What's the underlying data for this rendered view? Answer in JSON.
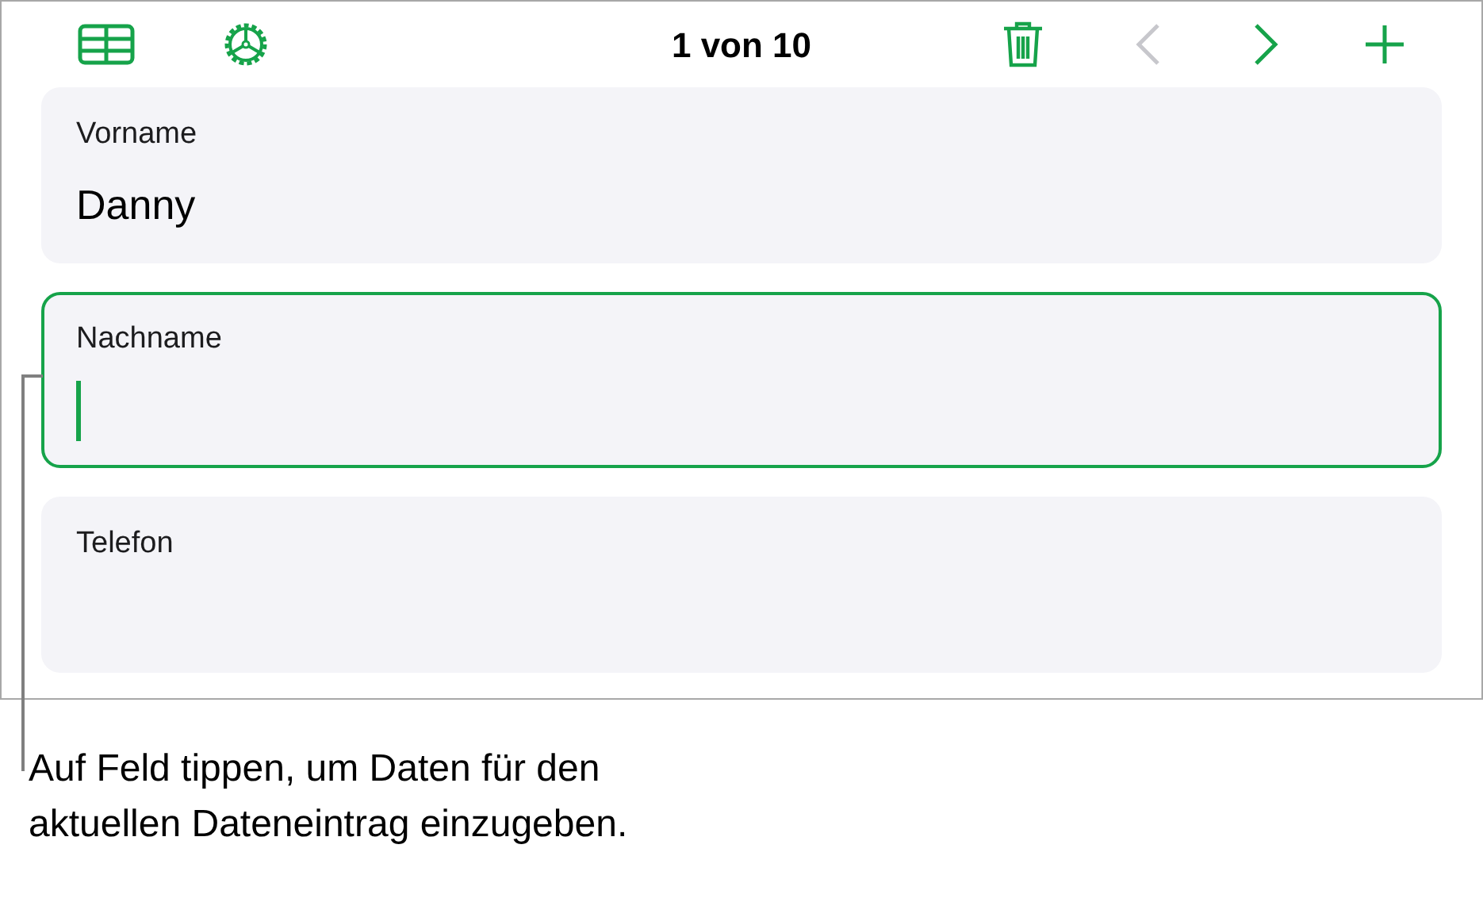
{
  "toolbar": {
    "record_counter": "1 von 10",
    "previous_disabled": true,
    "next_disabled": false
  },
  "fields": [
    {
      "label": "Vorname",
      "value": "Danny",
      "selected": false
    },
    {
      "label": "Nachname",
      "selected": true
    },
    {
      "label": "Telefon",
      "selected": false
    }
  ],
  "callout": "Auf Feld tippen, um Daten für den aktuellen Dateneintrag einzugeben."
}
